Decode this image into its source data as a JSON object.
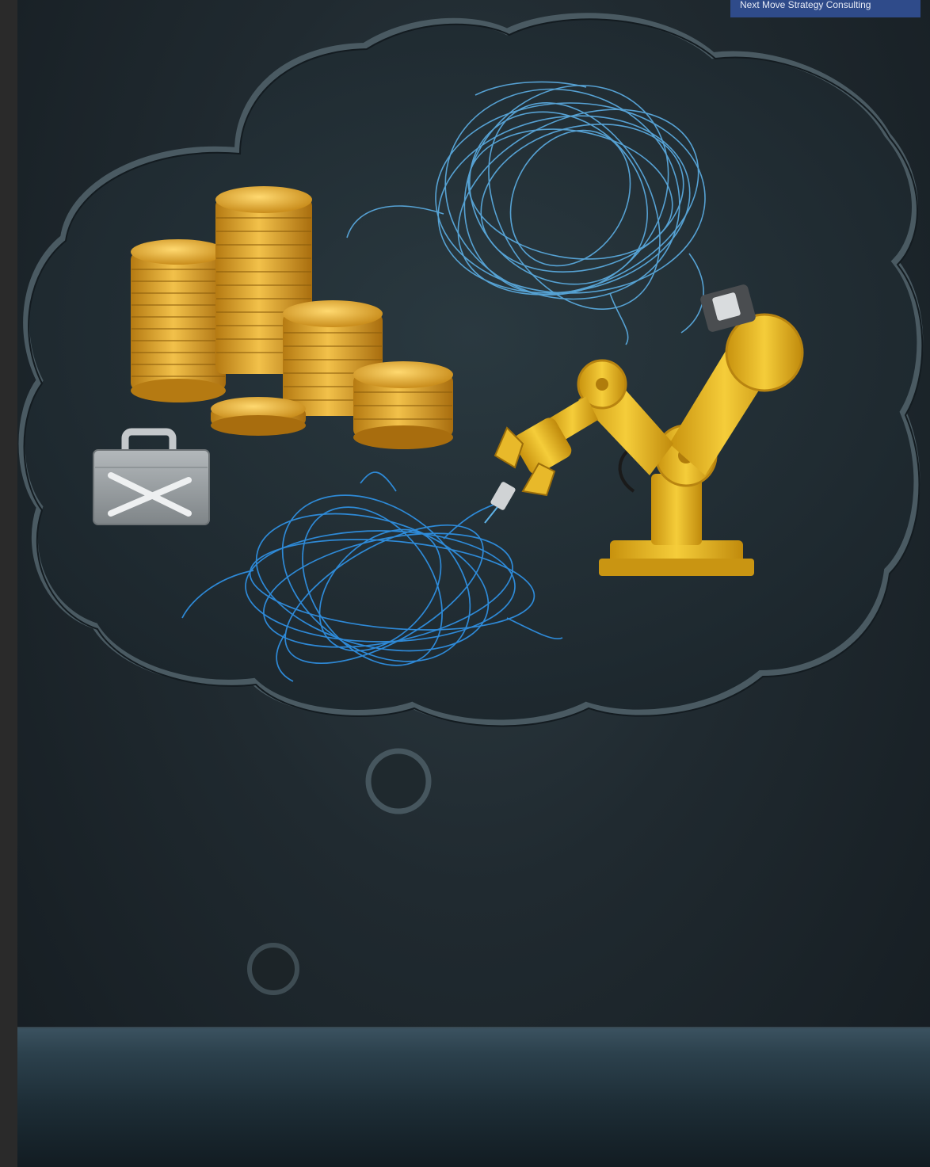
{
  "brand_tag": {
    "label": "Next Move Strategy Consulting"
  },
  "colors": {
    "background": "#1e282e",
    "cloud_outline": "#4a5a62",
    "coins": "#e0a62a",
    "tangled_wires": "#3fa0e8",
    "robot_arm": "#e8b92a",
    "toolbox": "#9aa0a4",
    "brand_tag_bg": "#2f4b8a"
  },
  "icons": [
    "thought-cloud",
    "gold-coin-stacks",
    "toolbox-icon",
    "tangled-wire-ball",
    "robot-arm-icon"
  ]
}
